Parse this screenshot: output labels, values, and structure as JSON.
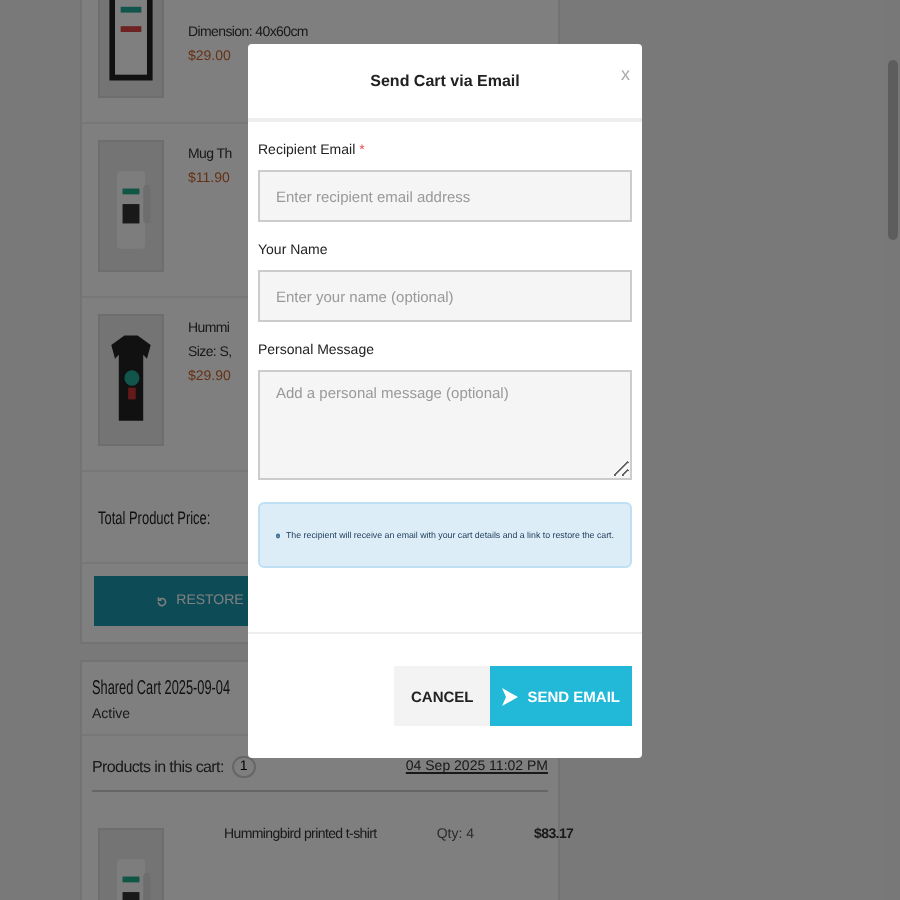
{
  "background": {
    "products": [
      {
        "lines": [
          "Dimension: 40x60cm"
        ],
        "price": "$29.00"
      },
      {
        "lines": [
          "Mug Th"
        ],
        "price": "$11.90"
      },
      {
        "lines": [
          "Hummi",
          "Size: S,"
        ],
        "price": "$29.90"
      }
    ],
    "total_label": "Total Product Price:",
    "restore_button": "RESTORE",
    "shared_cart": {
      "title": "Shared Cart 2025-09-04",
      "status": "Active",
      "products_label": "Products in this cart:",
      "count": "1",
      "date": "04 Sep 2025 11:02 PM",
      "items": [
        {
          "name": "Hummingbird printed t-shirt",
          "qty": "Qty: 4",
          "price": "$83.17"
        }
      ]
    }
  },
  "dialog": {
    "title": "Send Cart via Email",
    "close": "x",
    "fields": [
      {
        "label": "Recipient Email",
        "required_mark": "*",
        "placeholder": "Enter recipient email address",
        "kind": "input"
      },
      {
        "label": "Your Name",
        "placeholder": "Enter your name (optional)",
        "kind": "input"
      },
      {
        "label": "Personal Message",
        "placeholder": "Add a personal message (optional)",
        "kind": "textarea"
      }
    ],
    "info": "The recipient will receive an email with your cart details and a link to restore the cart.",
    "buttons": [
      {
        "label": "CANCEL",
        "kind": "secondary"
      },
      {
        "label": "SEND EMAIL",
        "kind": "primary"
      }
    ]
  }
}
